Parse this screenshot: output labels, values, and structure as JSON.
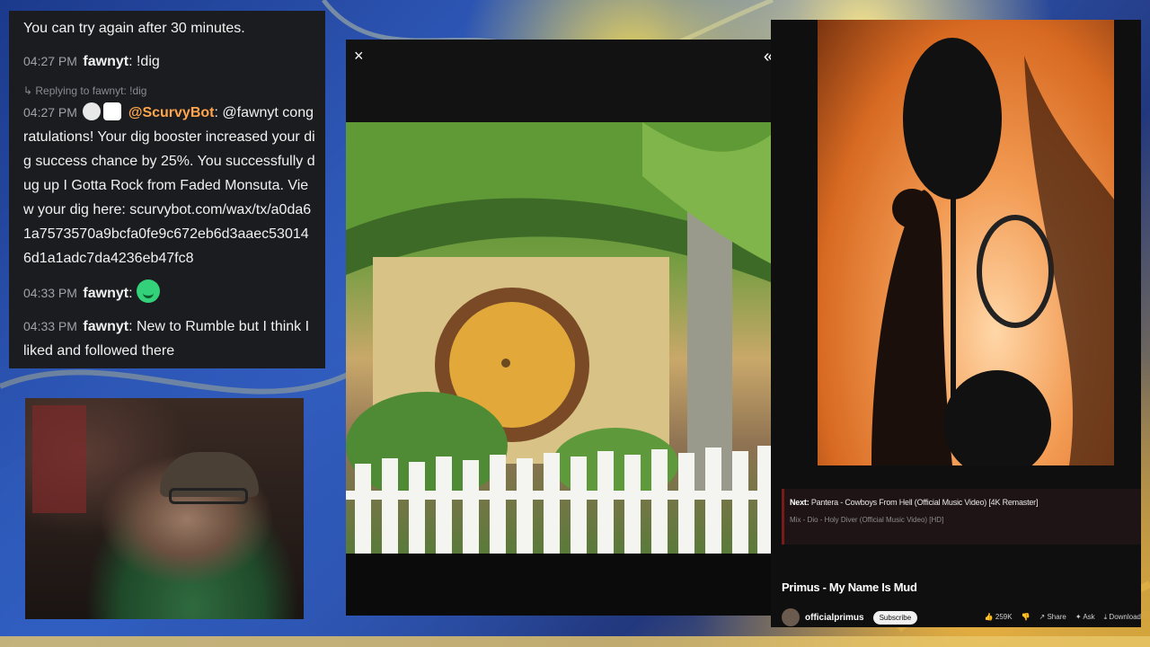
{
  "chat": {
    "messages": [
      {
        "text": "You can try again after 30 minutes."
      },
      {
        "time": "04:27 PM",
        "user": "fawnyt",
        "text": "!dig"
      },
      {
        "reply_to": "Replying to fawnyt: !dig",
        "time": "04:27 PM",
        "user": "@ScurvyBot",
        "text": "@fawnyt congratulations! Your dig booster increased your dig success chance by 25%. You successfully dug up I Gotta Rock from Faded Monsuta. View your dig here: scurvybot.com/wax/tx/a0da61a7573570a9bcfa0fe9c672eb6d3aaec530146d1a1adc7da4236eb47fc8"
      },
      {
        "time": "04:33 PM",
        "user": "fawnyt",
        "text": ""
      },
      {
        "time": "04:33 PM",
        "user": "fawnyt",
        "text": "New to Rumble but I think I liked and followed there"
      }
    ]
  },
  "viewer": {
    "close_label": "×",
    "collapse_label": "«"
  },
  "youtube": {
    "next_label": "Next:",
    "next_title": "Pantera - Cowboys From Hell (Official Music Video) [4K Remaster]",
    "mix_title": "Mix - Dio - Holy Diver (Official Music Video) [HD]",
    "video_title": "Primus - My Name Is Mud",
    "channel": "officialprimus",
    "subscribe": "Subscribe",
    "likes": "259K",
    "share": "Share",
    "ask": "Ask",
    "download": "Download",
    "accent": "#ff0000"
  }
}
